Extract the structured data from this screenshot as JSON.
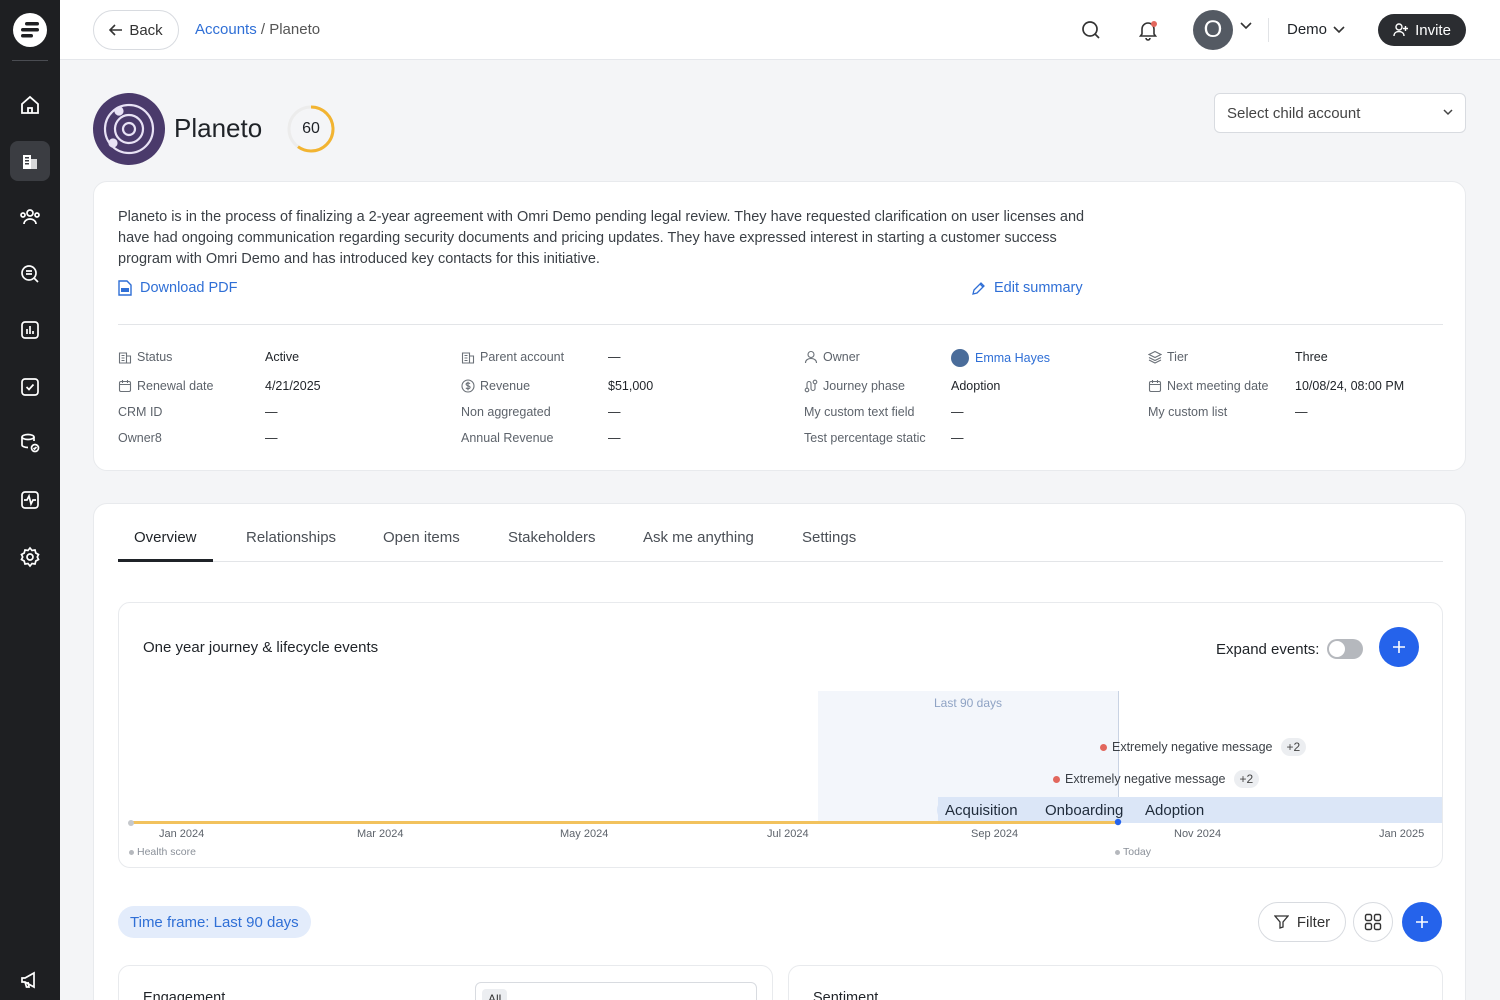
{
  "topbar": {
    "back_label": "Back",
    "breadcrumb_link": "Accounts",
    "breadcrumb_sep": " / ",
    "breadcrumb_current": "Planeto",
    "avatar_initial": "O",
    "workspace": "Demo",
    "invite_label": "Invite"
  },
  "account": {
    "name": "Planeto",
    "health_score": "60",
    "health_score_value": 60,
    "child_select_placeholder": "Select child account"
  },
  "summary": {
    "text": "Planeto is in the process of finalizing a 2-year agreement with Omri Demo pending legal review. They have requested clarification on user licenses and have had ongoing communication regarding security documents and pricing updates. They have expressed interest in starting a customer success program with Omri Demo and has introduced key contacts for this initiative.",
    "download_label": "Download PDF",
    "edit_label": "Edit summary"
  },
  "fields": [
    {
      "label": "Status",
      "value": "Active",
      "icon": "building-icon"
    },
    {
      "label": "Parent account",
      "value": "—",
      "icon": "building-icon"
    },
    {
      "label": "Owner",
      "value": "Emma Hayes",
      "icon": "user-icon"
    },
    {
      "label": "Tier",
      "value": "Three",
      "icon": "layers-icon"
    },
    {
      "label": "Renewal date",
      "value": "4/21/2025",
      "icon": "calendar-icon"
    },
    {
      "label": "Revenue",
      "value": "$51,000",
      "icon": "dollar-icon"
    },
    {
      "label": "Journey phase",
      "value": "Adoption",
      "icon": "route-icon"
    },
    {
      "label": "Next meeting date",
      "value": "10/08/24, 08:00 PM",
      "icon": "calendar-icon"
    },
    {
      "label": "CRM ID",
      "value": "—"
    },
    {
      "label": "Non aggregated",
      "value": "—"
    },
    {
      "label": "My custom text field",
      "value": "—"
    },
    {
      "label": "My custom list",
      "value": "—"
    },
    {
      "label": "Owner8",
      "value": "—"
    },
    {
      "label": "Annual Revenue",
      "value": "—"
    },
    {
      "label": "Test percentage static",
      "value": "—"
    }
  ],
  "tabs": [
    "Overview",
    "Relationships",
    "Open items",
    "Stakeholders",
    "Ask me anything",
    "Settings"
  ],
  "journey": {
    "title": "One year journey & lifecycle events",
    "expand_label": "Expand events",
    "expand_colon": ":",
    "expand_on": false,
    "window_label": "Last 90 days",
    "events": [
      {
        "label": "Extremely negative message",
        "more": "+2"
      },
      {
        "label": "Extremely negative message",
        "more": "+2"
      }
    ],
    "phases": [
      "Acquisition",
      "Onboarding",
      "Adoption"
    ],
    "months": [
      "Jan 2024",
      "Mar 2024",
      "May 2024",
      "Jul 2024",
      "Sep 2024",
      "Nov 2024",
      "Jan 2025"
    ],
    "series_label": "Health score",
    "today_label": "Today"
  },
  "controls": {
    "timeframe": "Time frame: Last 90 days",
    "filter_label": "Filter"
  },
  "widgets": {
    "engagement_title": "Engagement",
    "engagement_filter": "All",
    "sentiment_title": "Sentiment"
  },
  "colors": {
    "accent": "#2563eb",
    "link": "#2f6fd6",
    "health_line": "#f2c25d",
    "negative_event": "#e2675d",
    "phase_fill": "#dbe6f7"
  }
}
